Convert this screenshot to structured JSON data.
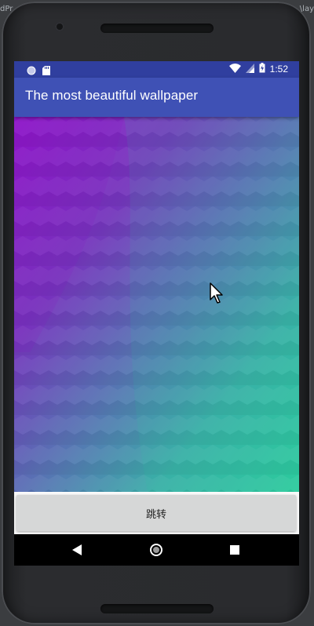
{
  "ide": {
    "left_text": "dPr",
    "right_text": "\\lay"
  },
  "status_bar": {
    "time": "1:52",
    "left_icons": [
      "circle-notification-icon",
      "sd-card-icon"
    ],
    "right_icons": [
      "wifi-icon",
      "signal-icon",
      "battery-charging-icon"
    ]
  },
  "app_bar": {
    "title": "The most beautiful wallpaper"
  },
  "wallpaper": {
    "description": "",
    "gradient_colors": [
      "#8a17c7",
      "#6b50b6",
      "#4c8fb0",
      "#2dc79f"
    ]
  },
  "button": {
    "label": "跳转"
  },
  "nav_bar": {
    "icons": [
      "back-icon",
      "home-icon",
      "recents-icon"
    ]
  },
  "colors": {
    "status_bar": "#303f9f",
    "app_bar": "#3f51b5",
    "button": "#d6d7d7"
  }
}
